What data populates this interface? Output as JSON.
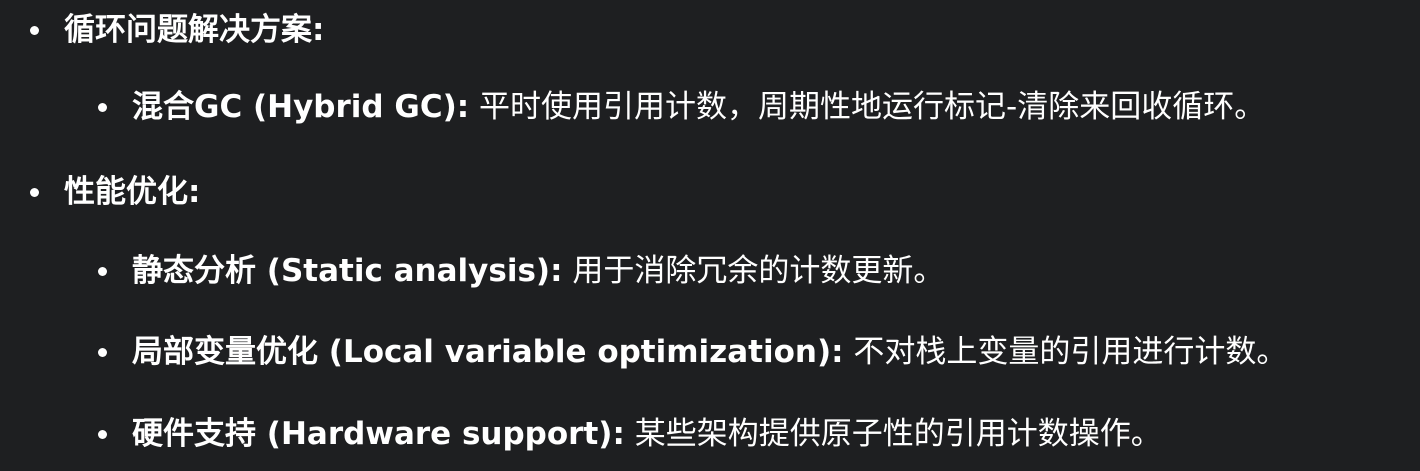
{
  "items": [
    {
      "level": 1,
      "label": "循环问题解决方案:",
      "text": ""
    },
    {
      "level": 2,
      "label": "混合GC (Hybrid GC):",
      "text": " 平时使用引用计数，周期性地运行标记-清除来回收循环。"
    },
    {
      "level": 1,
      "label": "性能优化:",
      "text": ""
    },
    {
      "level": 2,
      "label": "静态分析 (Static analysis):",
      "text": " 用于消除冗余的计数更新。"
    },
    {
      "level": 2,
      "label": "局部变量优化 (Local variable optimization):",
      "text": " 不对栈上变量的引用进行计数。"
    },
    {
      "level": 2,
      "label": "硬件支持 (Hardware support):",
      "text": " 某些架构提供原子性的引用计数操作。"
    }
  ]
}
